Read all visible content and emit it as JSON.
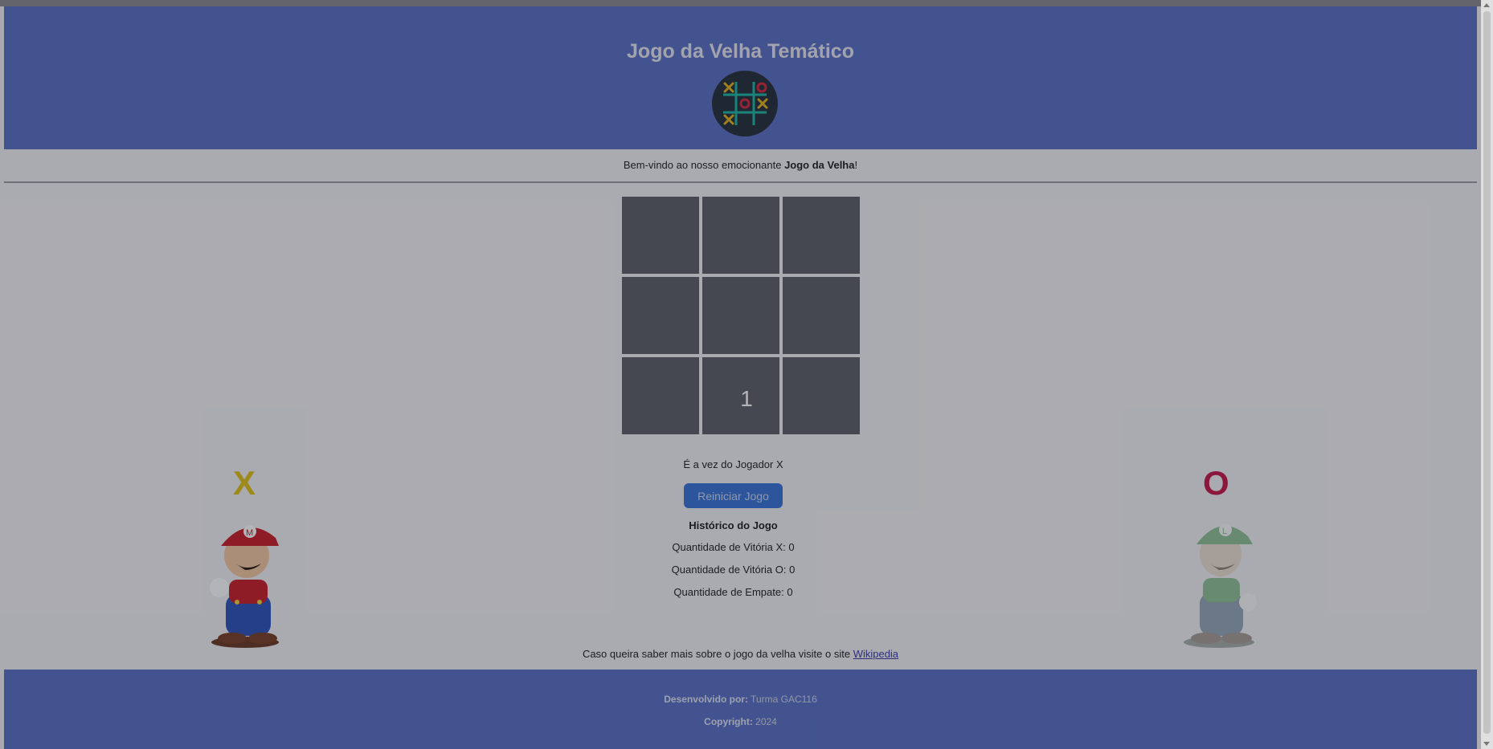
{
  "header": {
    "title": "Jogo da Velha Temático",
    "logo_icon": "tic-tac-toe-logo-icon"
  },
  "welcome": {
    "prefix": "Bem-vindo ao nosso emocionante ",
    "bold": "Jogo da Velha",
    "suffix": "!"
  },
  "board": {
    "cells": [
      "",
      "",
      "",
      "",
      "",
      "",
      "",
      "1",
      ""
    ]
  },
  "status": {
    "turn": "É a vez do Jogador X"
  },
  "buttons": {
    "restart_label": "Reiniciar Jogo"
  },
  "history": {
    "title": "Histórico do Jogo",
    "wins_x": "Quantidade de Vitória X: 0",
    "wins_o": "Quantidade de Vitória O: 0",
    "draws": "Quantidade de Empate: 0"
  },
  "players": {
    "x": {
      "letter": "X",
      "color": "#e0c01a",
      "character_icon": "mario-icon"
    },
    "o": {
      "letter": "O",
      "color": "#c4184a",
      "character_icon": "luigi-icon"
    }
  },
  "info": {
    "text": "Caso queira saber mais sobre o jogo da velha visite o site ",
    "link": "Wikipedia"
  },
  "footer": {
    "dev_label": "Desenvolvido por:",
    "dev_value": " Turma GAC116",
    "copy_label": "Copyright:",
    "copy_value": " 2024"
  },
  "colors": {
    "header_bg": "#5b70c4",
    "button_bg": "#3a74d6",
    "cell_bg": "#5e6068"
  }
}
